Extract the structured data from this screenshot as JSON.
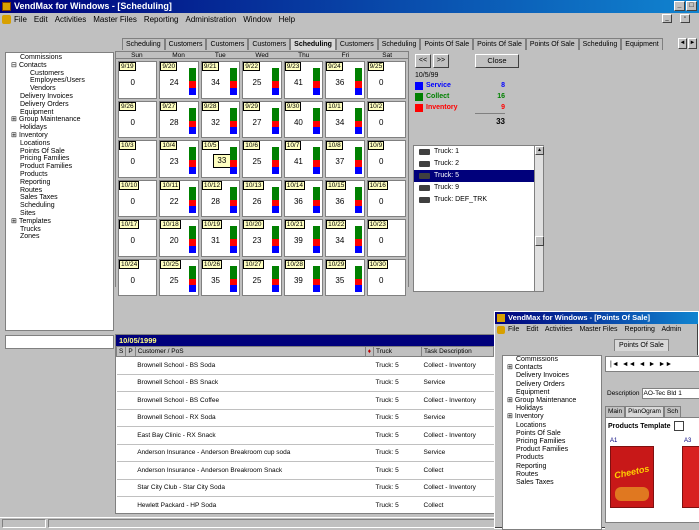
{
  "main_window": {
    "title": "VendMax for Windows - [Scheduling]",
    "menu": [
      "File",
      "Edit",
      "Activities",
      "Master Files",
      "Reporting",
      "Administration",
      "Window",
      "Help"
    ]
  },
  "tabs": [
    "Scheduling",
    "Customers",
    "Customers",
    "Customers",
    "Scheduling",
    "Customers",
    "Scheduling",
    "Points Of Sale",
    "Points Of Sale",
    "Points Of Sale",
    "Scheduling",
    "Equipment"
  ],
  "active_tab_index": 4,
  "sidebar": {
    "items": [
      {
        "label": "Commissions",
        "level": 0,
        "mark": ""
      },
      {
        "label": "Contacts",
        "level": 0,
        "mark": "⊟"
      },
      {
        "label": "Customers",
        "level": 1,
        "mark": ""
      },
      {
        "label": "Employees/Users",
        "level": 1,
        "mark": ""
      },
      {
        "label": "Vendors",
        "level": 1,
        "mark": ""
      },
      {
        "label": "Delivery Invoices",
        "level": 0,
        "mark": ""
      },
      {
        "label": "Delivery Orders",
        "level": 0,
        "mark": ""
      },
      {
        "label": "Equipment",
        "level": 0,
        "mark": ""
      },
      {
        "label": "Group Maintenance",
        "level": 0,
        "mark": "⊞"
      },
      {
        "label": "Holidays",
        "level": 0,
        "mark": ""
      },
      {
        "label": "Inventory",
        "level": 0,
        "mark": "⊞"
      },
      {
        "label": "Locations",
        "level": 0,
        "mark": ""
      },
      {
        "label": "Points Of Sale",
        "level": 0,
        "mark": ""
      },
      {
        "label": "Pricing Families",
        "level": 0,
        "mark": ""
      },
      {
        "label": "Product Families",
        "level": 0,
        "mark": ""
      },
      {
        "label": "Products",
        "level": 0,
        "mark": ""
      },
      {
        "label": "Reporting",
        "level": 0,
        "mark": ""
      },
      {
        "label": "Routes",
        "level": 0,
        "mark": ""
      },
      {
        "label": "Sales Taxes",
        "level": 0,
        "mark": ""
      },
      {
        "label": "Scheduling",
        "level": 0,
        "mark": ""
      },
      {
        "label": "Sites",
        "level": 0,
        "mark": ""
      },
      {
        "label": "Templates",
        "level": 0,
        "mark": "⊞"
      },
      {
        "label": "Trucks",
        "level": 0,
        "mark": ""
      },
      {
        "label": "Zones",
        "level": 0,
        "mark": ""
      }
    ]
  },
  "calendar": {
    "day_headers": [
      "Sun",
      "Mon",
      "Tue",
      "Wed",
      "Thu",
      "Fri",
      "Sat"
    ],
    "weeks": [
      [
        {
          "d": "9/19",
          "n": "0"
        },
        {
          "d": "9/20",
          "n": "24"
        },
        {
          "d": "9/21",
          "n": "34"
        },
        {
          "d": "9/22",
          "n": "25"
        },
        {
          "d": "9/23",
          "n": "41"
        },
        {
          "d": "9/24",
          "n": "36"
        },
        {
          "d": "9/25",
          "n": "0"
        }
      ],
      [
        {
          "d": "9/26",
          "n": "0"
        },
        {
          "d": "9/27",
          "n": "28"
        },
        {
          "d": "9/28",
          "n": "32"
        },
        {
          "d": "9/29",
          "n": "27"
        },
        {
          "d": "9/30",
          "n": "40"
        },
        {
          "d": "10/1",
          "n": "34"
        },
        {
          "d": "10/2",
          "n": "0"
        }
      ],
      [
        {
          "d": "10/3",
          "n": "0"
        },
        {
          "d": "10/4",
          "n": "23"
        },
        {
          "d": "10/5",
          "n": "33"
        },
        {
          "d": "10/6",
          "n": "25"
        },
        {
          "d": "10/7",
          "n": "41"
        },
        {
          "d": "10/8",
          "n": "37"
        },
        {
          "d": "10/9",
          "n": "0"
        }
      ],
      [
        {
          "d": "10/10",
          "n": "0"
        },
        {
          "d": "10/11",
          "n": "22"
        },
        {
          "d": "10/12",
          "n": "28"
        },
        {
          "d": "10/13",
          "n": "26"
        },
        {
          "d": "10/14",
          "n": "36"
        },
        {
          "d": "10/15",
          "n": "36"
        },
        {
          "d": "10/16",
          "n": "0"
        }
      ],
      [
        {
          "d": "10/17",
          "n": "0"
        },
        {
          "d": "10/18",
          "n": "20"
        },
        {
          "d": "10/19",
          "n": "31"
        },
        {
          "d": "10/20",
          "n": "23"
        },
        {
          "d": "10/21",
          "n": "39"
        },
        {
          "d": "10/22",
          "n": "34"
        },
        {
          "d": "10/23",
          "n": "0"
        }
      ],
      [
        {
          "d": "10/24",
          "n": "0"
        },
        {
          "d": "10/25",
          "n": "25"
        },
        {
          "d": "10/26",
          "n": "35"
        },
        {
          "d": "10/27",
          "n": "25"
        },
        {
          "d": "10/28",
          "n": "39"
        },
        {
          "d": "10/29",
          "n": "35"
        },
        {
          "d": "10/30",
          "n": "0"
        }
      ]
    ],
    "selected": "10/5"
  },
  "controls": {
    "prev_label": "<<",
    "next_label": ">>",
    "close_label": "Close"
  },
  "summary": {
    "date": "10/5/99",
    "rows": [
      {
        "label": "Service",
        "value": "8",
        "color": "#0000ff"
      },
      {
        "label": "Collect",
        "value": "16",
        "color": "#008000"
      },
      {
        "label": "Inventory",
        "value": "9",
        "color": "#ff0000"
      }
    ],
    "total": "33"
  },
  "trucks": {
    "items": [
      "Truck: 1",
      "Truck: 2",
      "Truck: 5",
      "Truck: 9",
      "Truck: DEF_TRK"
    ],
    "selected_index": 2
  },
  "detail": {
    "date": "10/05/1999",
    "columns": [
      "S",
      "P",
      "Customer / PoS",
      "",
      "Truck",
      "Task Description"
    ],
    "rows": [
      {
        "customer": "Brownell School - BS Soda",
        "truck": "Truck: 5",
        "task": "Collect - Inventory"
      },
      {
        "customer": "Brownell School - BS Snack",
        "truck": "Truck: 5",
        "task": "Service"
      },
      {
        "customer": "Brownell School - BS Coffee",
        "truck": "Truck: 5",
        "task": "Collect - Inventory"
      },
      {
        "customer": "Brownell School - RX Soda",
        "truck": "Truck: 5",
        "task": "Service"
      },
      {
        "customer": "East Bay Clinic - RX Snack",
        "truck": "Truck: 5",
        "task": "Collect - Inventory"
      },
      {
        "customer": "Anderson Insurance - Anderson Breakroom cup soda",
        "truck": "Truck: 5",
        "task": "Service"
      },
      {
        "customer": "Anderson Insurance - Anderson Breakroom Snack",
        "truck": "Truck: 5",
        "task": "Collect"
      },
      {
        "customer": "Star City Club - Star City Soda",
        "truck": "Truck: 5",
        "task": "Collect - Inventory"
      },
      {
        "customer": "Hewlett Packard - HP Soda",
        "truck": "Truck: 5",
        "task": "Collect"
      }
    ]
  },
  "second_window": {
    "title": "VendMax for Windows - [Points Of Sale]",
    "menu": [
      "File",
      "Edit",
      "Activities",
      "Master Files",
      "Reporting",
      "Admin"
    ],
    "tab": "Points Of Sale",
    "sidebar": [
      "Commissions",
      "Contacts",
      "Delivery Invoices",
      "Delivery Orders",
      "Equipment",
      "Group Maintenance",
      "Holidays",
      "Inventory",
      "Locations",
      "Points Of Sale",
      "Pricing Families",
      "Product Families",
      "Products",
      "Reporting",
      "Routes",
      "Sales Taxes"
    ],
    "sidebar_expandable": [
      1,
      5,
      7
    ],
    "description_label": "Description",
    "description_value": "AO-Tec Bld 1",
    "subtabs": [
      "Main",
      "PlanOgram",
      "Sch"
    ],
    "template_title": "Products Template",
    "slot_a1": "A1",
    "slot_a3": "A3",
    "brand": "Cheetos"
  }
}
